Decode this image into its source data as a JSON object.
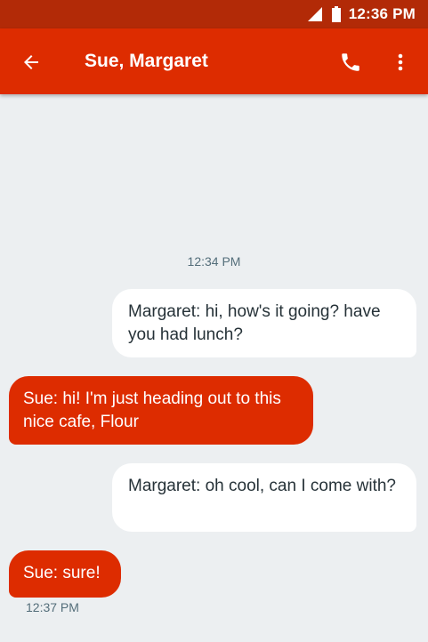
{
  "status_bar": {
    "time": "12:36 PM",
    "icons": [
      "signal-icon",
      "battery-icon"
    ]
  },
  "app_bar": {
    "title": "Sue, Margaret",
    "back_icon": "arrow-back-icon",
    "call_icon": "phone-icon",
    "menu_icon": "more-vert-icon"
  },
  "colors": {
    "status_bar": "#b22a07",
    "accent": "#dd2c00",
    "background": "#eceff1",
    "outgoing_bubble": "#ffffff",
    "timestamp_text": "#546e7a"
  },
  "thread": {
    "timestamp_top": "12:34 PM",
    "messages": [
      {
        "direction": "outgoing",
        "text": "Margaret: hi, how's it going? have you had lunch?"
      },
      {
        "direction": "incoming",
        "text": "Sue: hi! I'm just heading out to this nice cafe, Flour"
      },
      {
        "direction": "outgoing",
        "text": "Margaret: oh cool, can I come with?"
      },
      {
        "direction": "incoming",
        "text": "Sue: sure!"
      }
    ],
    "timestamp_bottom": "12:37 PM"
  }
}
